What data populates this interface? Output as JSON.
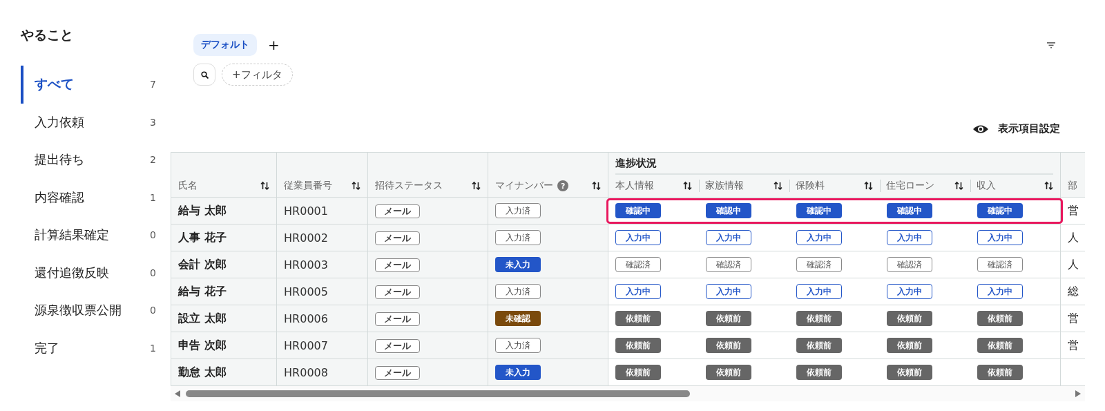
{
  "sidebar": {
    "title": "やること",
    "items": [
      {
        "label": "すべて",
        "count": "7",
        "selected": true
      },
      {
        "label": "入力依頼",
        "count": "3",
        "selected": false
      },
      {
        "label": "提出待ち",
        "count": "2",
        "selected": false
      },
      {
        "label": "内容確認",
        "count": "1",
        "selected": false
      },
      {
        "label": "計算結果確定",
        "count": "0",
        "selected": false
      },
      {
        "label": "還付追徴反映",
        "count": "0",
        "selected": false
      },
      {
        "label": "源泉徴収票公開",
        "count": "0",
        "selected": false
      },
      {
        "label": "完了",
        "count": "1",
        "selected": false
      }
    ]
  },
  "views": {
    "tabs": [
      {
        "label": "デフォルト",
        "selected": true
      }
    ],
    "add_label": "+"
  },
  "filter_button": "+フィルタ",
  "display_settings": "表示項目設定",
  "table": {
    "columns": [
      {
        "label": "氏名"
      },
      {
        "label": "従業員番号"
      },
      {
        "label": "招待ステータス"
      },
      {
        "label": "マイナンバー",
        "help": "?"
      }
    ],
    "group": {
      "label": "進捗状況",
      "columns": [
        "本人情報",
        "家族情報",
        "保険料",
        "住宅ローン",
        "収入"
      ]
    },
    "column_10": "部",
    "rows": [
      {
        "name": "給与 太郎",
        "id": "HR0001",
        "invite": "メール",
        "mynumber": {
          "label": "入力済",
          "kind": "entered"
        },
        "progress": [
          {
            "label": "確認中",
            "kind": "reviewing"
          },
          {
            "label": "確認中",
            "kind": "reviewing"
          },
          {
            "label": "確認中",
            "kind": "reviewing"
          },
          {
            "label": "確認中",
            "kind": "reviewing"
          },
          {
            "label": "確認中",
            "kind": "reviewing"
          }
        ],
        "column_10": "営",
        "highlighted": true
      },
      {
        "name": "人事 花子",
        "id": "HR0002",
        "invite": "メール",
        "mynumber": {
          "label": "入力済",
          "kind": "entered"
        },
        "progress": [
          {
            "label": "入力中",
            "kind": "inputting"
          },
          {
            "label": "入力中",
            "kind": "inputting"
          },
          {
            "label": "入力中",
            "kind": "inputting"
          },
          {
            "label": "入力中",
            "kind": "inputting"
          },
          {
            "label": "入力中",
            "kind": "inputting"
          }
        ],
        "column_10": "人",
        "highlighted": false
      },
      {
        "name": "会計 次郎",
        "id": "HR0003",
        "invite": "メール",
        "mynumber": {
          "label": "未入力",
          "kind": "missing"
        },
        "progress": [
          {
            "label": "確認済",
            "kind": "confirmed"
          },
          {
            "label": "確認済",
            "kind": "confirmed"
          },
          {
            "label": "確認済",
            "kind": "confirmed"
          },
          {
            "label": "確認済",
            "kind": "confirmed"
          },
          {
            "label": "確認済",
            "kind": "confirmed"
          }
        ],
        "column_10": "人",
        "highlighted": false
      },
      {
        "name": "給与 花子",
        "id": "HR0005",
        "invite": "メール",
        "mynumber": {
          "label": "入力済",
          "kind": "entered"
        },
        "progress": [
          {
            "label": "入力中",
            "kind": "inputting"
          },
          {
            "label": "入力中",
            "kind": "inputting"
          },
          {
            "label": "入力中",
            "kind": "inputting"
          },
          {
            "label": "入力中",
            "kind": "inputting"
          },
          {
            "label": "入力中",
            "kind": "inputting"
          }
        ],
        "column_10": "総",
        "highlighted": false
      },
      {
        "name": "設立 太郎",
        "id": "HR0006",
        "invite": "メール",
        "mynumber": {
          "label": "未確認",
          "kind": "unverified"
        },
        "progress": [
          {
            "label": "依頼前",
            "kind": "pending"
          },
          {
            "label": "依頼前",
            "kind": "pending"
          },
          {
            "label": "依頼前",
            "kind": "pending"
          },
          {
            "label": "依頼前",
            "kind": "pending"
          },
          {
            "label": "依頼前",
            "kind": "pending"
          }
        ],
        "column_10": "営",
        "highlighted": false
      },
      {
        "name": "申告 次郎",
        "id": "HR0007",
        "invite": "メール",
        "mynumber": {
          "label": "入力済",
          "kind": "entered"
        },
        "progress": [
          {
            "label": "依頼前",
            "kind": "pending"
          },
          {
            "label": "依頼前",
            "kind": "pending"
          },
          {
            "label": "依頼前",
            "kind": "pending"
          },
          {
            "label": "依頼前",
            "kind": "pending"
          },
          {
            "label": "依頼前",
            "kind": "pending"
          }
        ],
        "column_10": "営",
        "highlighted": false
      },
      {
        "name": "勤怠 太郎",
        "id": "HR0008",
        "invite": "メール",
        "mynumber": {
          "label": "未入力",
          "kind": "missing"
        },
        "progress": [
          {
            "label": "依頼前",
            "kind": "pending"
          },
          {
            "label": "依頼前",
            "kind": "pending"
          },
          {
            "label": "依頼前",
            "kind": "pending"
          },
          {
            "label": "依頼前",
            "kind": "pending"
          },
          {
            "label": "依頼前",
            "kind": "pending"
          }
        ],
        "highlighted": false
      }
    ]
  }
}
